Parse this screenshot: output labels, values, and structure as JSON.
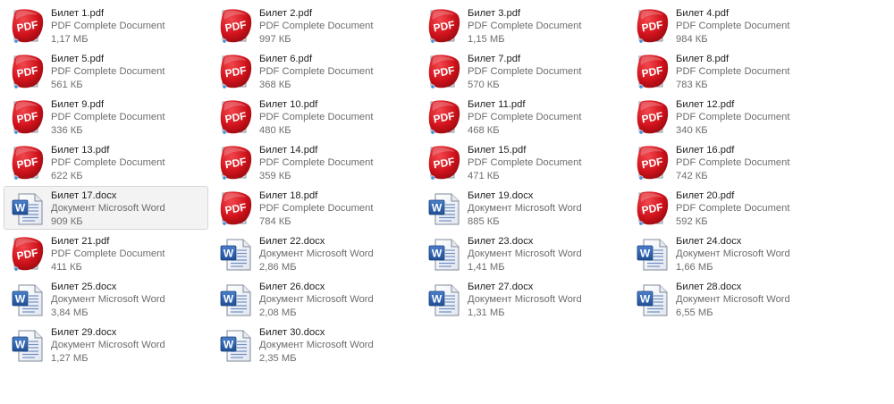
{
  "files": [
    {
      "name": "Билет 1.pdf",
      "type": "PDF Complete Document",
      "size": "1,17 МБ",
      "icon": "pdf-icon"
    },
    {
      "name": "Билет 2.pdf",
      "type": "PDF Complete Document",
      "size": "997 КБ",
      "icon": "pdf-icon"
    },
    {
      "name": "Билет 3.pdf",
      "type": "PDF Complete Document",
      "size": "1,15 МБ",
      "icon": "pdf-icon"
    },
    {
      "name": "Билет 4.pdf",
      "type": "PDF Complete Document",
      "size": "984 КБ",
      "icon": "pdf-icon"
    },
    {
      "name": "Билет 5.pdf",
      "type": "PDF Complete Document",
      "size": "561 КБ",
      "icon": "pdf-icon"
    },
    {
      "name": "Билет 6.pdf",
      "type": "PDF Complete Document",
      "size": "368 КБ",
      "icon": "pdf-icon"
    },
    {
      "name": "Билет 7.pdf",
      "type": "PDF Complete Document",
      "size": "570 КБ",
      "icon": "pdf-icon"
    },
    {
      "name": "Билет 8.pdf",
      "type": "PDF Complete Document",
      "size": "783 КБ",
      "icon": "pdf-icon"
    },
    {
      "name": "Билет 9.pdf",
      "type": "PDF Complete Document",
      "size": "336 КБ",
      "icon": "pdf-icon"
    },
    {
      "name": "Билет 10.pdf",
      "type": "PDF Complete Document",
      "size": "480 КБ",
      "icon": "pdf-icon"
    },
    {
      "name": "Билет 11.pdf",
      "type": "PDF Complete Document",
      "size": "468 КБ",
      "icon": "pdf-icon"
    },
    {
      "name": "Билет 12.pdf",
      "type": "PDF Complete Document",
      "size": "340 КБ",
      "icon": "pdf-icon"
    },
    {
      "name": "Билет 13.pdf",
      "type": "PDF Complete Document",
      "size": "622 КБ",
      "icon": "pdf-icon"
    },
    {
      "name": "Билет 14.pdf",
      "type": "PDF Complete Document",
      "size": "359 КБ",
      "icon": "pdf-icon"
    },
    {
      "name": "Билет 15.pdf",
      "type": "PDF Complete Document",
      "size": "471 КБ",
      "icon": "pdf-icon"
    },
    {
      "name": "Билет 16.pdf",
      "type": "PDF Complete Document",
      "size": "742 КБ",
      "icon": "pdf-icon"
    },
    {
      "name": "Билет 17.docx",
      "type": "Документ Microsoft Word",
      "size": "909 КБ",
      "icon": "word-document-icon",
      "selected": true
    },
    {
      "name": "Билет 18.pdf",
      "type": "PDF Complete Document",
      "size": "784 КБ",
      "icon": "pdf-icon"
    },
    {
      "name": "Билет 19.docx",
      "type": "Документ Microsoft Word",
      "size": "885 КБ",
      "icon": "word-document-icon"
    },
    {
      "name": "Билет 20.pdf",
      "type": "PDF Complete Document",
      "size": "592 КБ",
      "icon": "pdf-icon"
    },
    {
      "name": "Билет 21.pdf",
      "type": "PDF Complete Document",
      "size": "411 КБ",
      "icon": "pdf-icon"
    },
    {
      "name": "Билет 22.docx",
      "type": "Документ Microsoft Word",
      "size": "2,86 МБ",
      "icon": "word-document-icon"
    },
    {
      "name": "Билет 23.docx",
      "type": "Документ Microsoft Word",
      "size": "1,41 МБ",
      "icon": "word-document-icon"
    },
    {
      "name": "Билет 24.docx",
      "type": "Документ Microsoft Word",
      "size": "1,66 МБ",
      "icon": "word-document-icon"
    },
    {
      "name": "Билет 25.docx",
      "type": "Документ Microsoft Word",
      "size": "3,84 МБ",
      "icon": "word-document-icon"
    },
    {
      "name": "Билет 26.docx",
      "type": "Документ Microsoft Word",
      "size": "2,08 МБ",
      "icon": "word-document-icon"
    },
    {
      "name": "Билет 27.docx",
      "type": "Документ Microsoft Word",
      "size": "1,31 МБ",
      "icon": "word-document-icon"
    },
    {
      "name": "Билет 28.docx",
      "type": "Документ Microsoft Word",
      "size": "6,55 МБ",
      "icon": "word-document-icon"
    },
    {
      "name": "Билет 29.docx",
      "type": "Документ Microsoft Word",
      "size": "1,27 МБ",
      "icon": "word-document-icon"
    },
    {
      "name": "Билет 30.docx",
      "type": "Документ Microsoft Word",
      "size": "2,35 МБ",
      "icon": "word-document-icon"
    }
  ],
  "colors": {
    "pdf_red": "#d0121b",
    "word_blue": "#2b5ea8",
    "primary_text": "#1e1e1e",
    "secondary_text": "#6d6d6d",
    "selection_bg": "#f3f3f3"
  }
}
